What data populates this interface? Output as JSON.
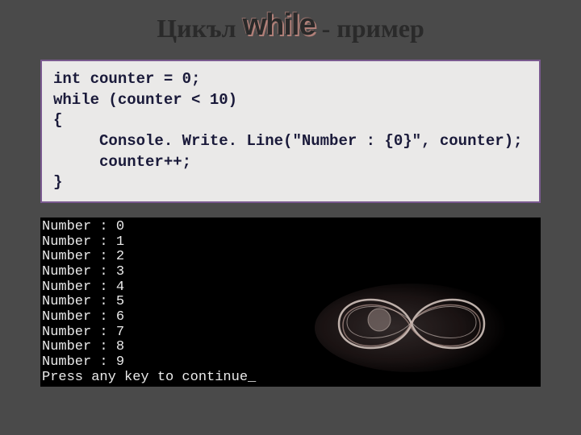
{
  "title": {
    "part1": "Цикъл ",
    "while": "while",
    "part2": " - пример"
  },
  "code": "int counter = 0;\nwhile (counter < 10)\n{\n     Console. Write. Line(\"Number : {0}\", counter);\n     counter++;\n}",
  "console_output": "Number : 0\nNumber : 1\nNumber : 2\nNumber : 3\nNumber : 4\nNumber : 5\nNumber : 6\nNumber : 7\nNumber : 8\nNumber : 9\nPress any key to continue_"
}
